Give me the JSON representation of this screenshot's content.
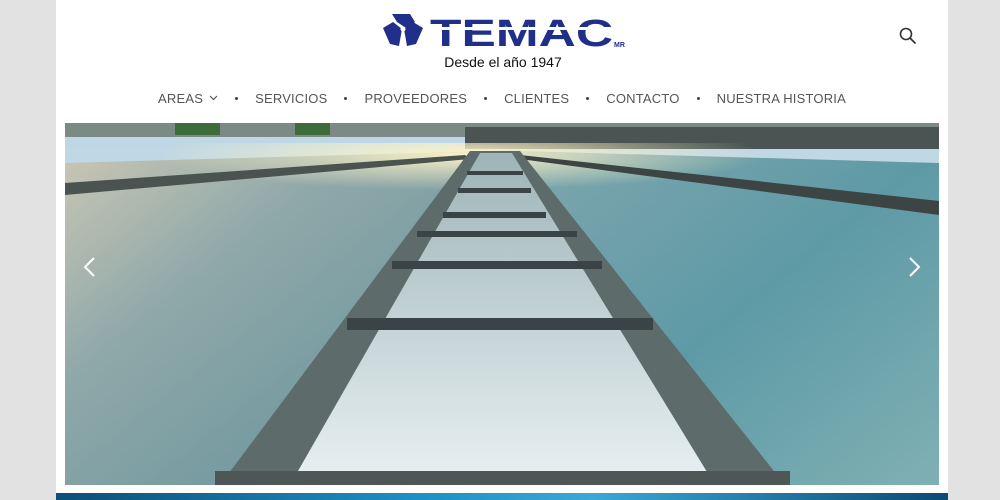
{
  "brand": {
    "name": "TEMAC",
    "mark": "MR",
    "tagline": "Desde el año 1947",
    "color": "#1f2f8a"
  },
  "header": {
    "search_icon": "search-icon"
  },
  "nav": {
    "items": [
      {
        "label": "AREAS",
        "has_dropdown": true
      },
      {
        "label": "SERVICIOS"
      },
      {
        "label": "PROVEEDORES"
      },
      {
        "label": "CLIENTES"
      },
      {
        "label": "CONTACTO"
      },
      {
        "label": "NUESTRA HISTORIA"
      }
    ]
  },
  "slider": {
    "prev_icon": "chevron-left-icon",
    "next_icon": "chevron-right-icon",
    "image": "water-treatment-channel-photo"
  },
  "colors": {
    "nav_text": "#555555",
    "background": "#e2e2e2",
    "strip": "#1d8fc4"
  }
}
